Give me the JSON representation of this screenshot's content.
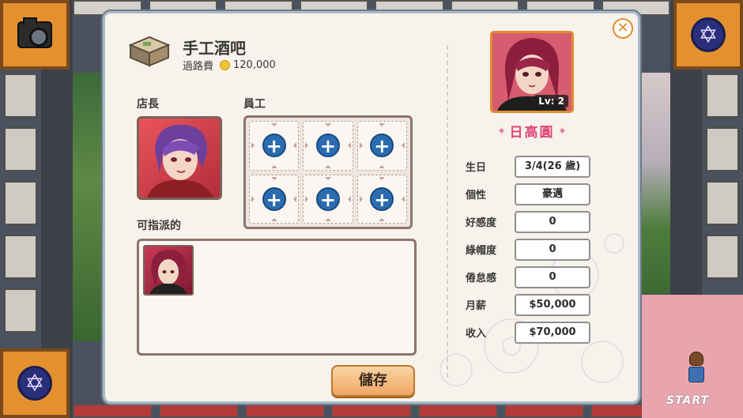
{
  "shop": {
    "name": "手工酒吧",
    "toll_label": "過路費",
    "toll_amount": "120,000"
  },
  "labels": {
    "manager": "店長",
    "staff": "員工",
    "assignable": "可指派的",
    "save": "儲存"
  },
  "staff_slots": [
    {
      "icon": "plus-icon",
      "symbol": "+"
    },
    {
      "icon": "plus-icon",
      "symbol": "+"
    },
    {
      "icon": "plus-icon",
      "symbol": "+"
    },
    {
      "icon": "plus-icon",
      "symbol": "+"
    },
    {
      "icon": "plus-icon",
      "symbol": "+"
    },
    {
      "icon": "plus-icon",
      "symbol": "+"
    }
  ],
  "character": {
    "name": "日高圓",
    "level": "Lv: 2",
    "stats": [
      {
        "label": "生日",
        "value": "3/4(26 歲)"
      },
      {
        "label": "個性",
        "value": "豪邁"
      },
      {
        "label": "好感度",
        "value": "0"
      },
      {
        "label": "綠帽度",
        "value": "0"
      },
      {
        "label": "倦怠感",
        "value": "0"
      },
      {
        "label": "月薪",
        "value": "$50,000"
      },
      {
        "label": "收入",
        "value": "$70,000"
      }
    ]
  },
  "board": {
    "start_label": "START"
  },
  "icons": {
    "close": "close-icon",
    "coin": "coin-icon",
    "camera": "camera-icon",
    "hexagram": "hexagram-icon"
  },
  "colors": {
    "accent_orange": "#e38c2c",
    "name_pink": "#e0487a",
    "plus_blue": "#2b6cb0",
    "frame_brown": "#8c7569"
  }
}
